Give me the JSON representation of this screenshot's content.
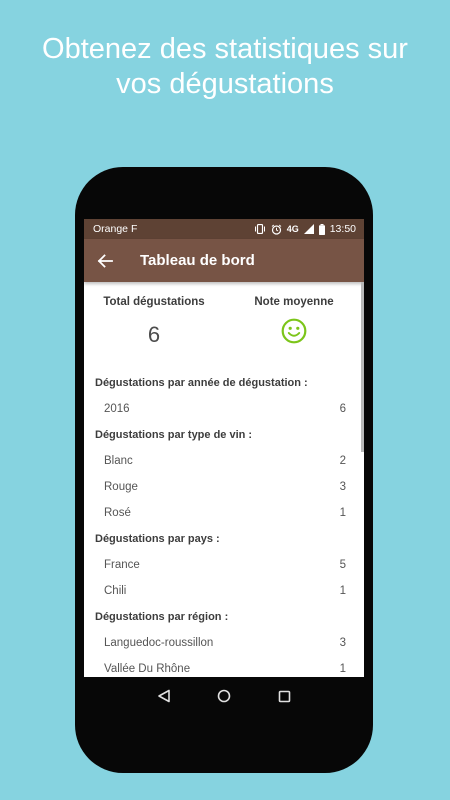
{
  "headline": {
    "line1": "Obtenez des statistiques sur",
    "line2": "vos dégustations"
  },
  "statusbar": {
    "carrier": "Orange F",
    "network": "4G",
    "time": "13:50",
    "icons": [
      "vibrate-icon",
      "alarm-icon",
      "signal-icon",
      "battery-icon"
    ]
  },
  "toolbar": {
    "title": "Tableau de bord",
    "back_icon": "arrow-left-icon"
  },
  "summary": {
    "total_label": "Total dégustations",
    "total_value": "6",
    "rating_label": "Note moyenne",
    "rating_icon": "smiley-icon"
  },
  "sections": [
    {
      "title": "Dégustations par année de dégustation :",
      "rows": [
        {
          "label": "2016",
          "count": "6"
        }
      ]
    },
    {
      "title": "Dégustations par type de vin :",
      "rows": [
        {
          "label": "Blanc",
          "count": "2"
        },
        {
          "label": "Rouge",
          "count": "3"
        },
        {
          "label": "Rosé",
          "count": "1"
        }
      ]
    },
    {
      "title": "Dégustations par pays :",
      "rows": [
        {
          "label": "France",
          "count": "5"
        },
        {
          "label": "Chili",
          "count": "1"
        }
      ]
    },
    {
      "title": "Dégustations par région :",
      "rows": [
        {
          "label": "Languedoc-roussillon",
          "count": "3"
        },
        {
          "label": "Vallée Du Rhône",
          "count": "1"
        }
      ]
    }
  ],
  "navbar": {
    "icons": [
      "back-triangle-icon",
      "home-circle-icon",
      "recents-square-icon"
    ]
  },
  "colors": {
    "background": "#86d3e0",
    "statusbar": "#5e4234",
    "toolbar": "#775445",
    "smiley": "#7cc51a"
  }
}
